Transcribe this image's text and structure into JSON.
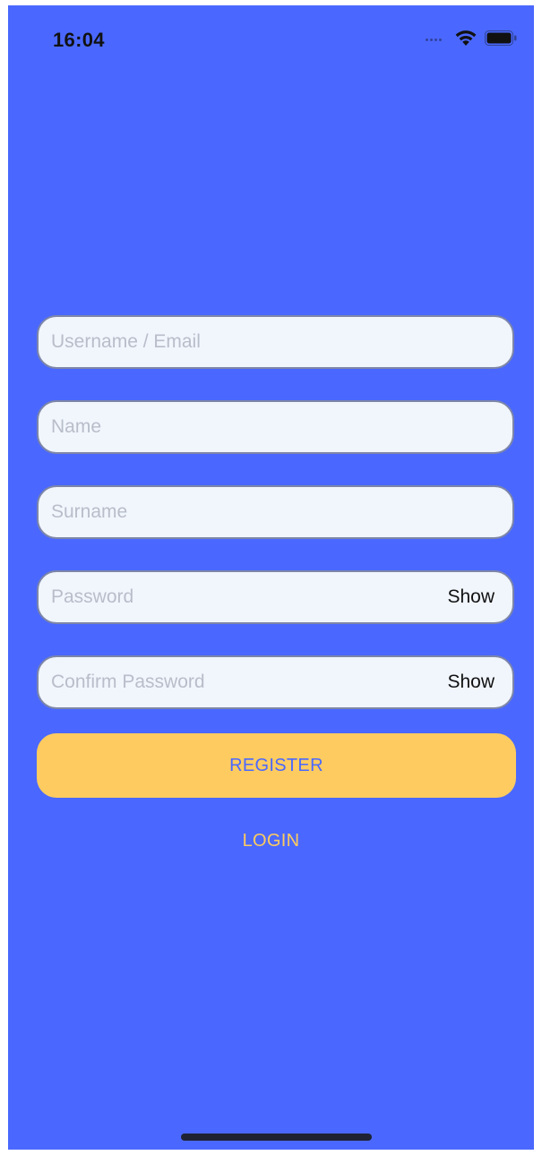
{
  "status_bar": {
    "time": "16:04",
    "signal_icon": "cellular-dots-icon",
    "wifi_icon": "wifi-icon",
    "battery_icon": "battery-icon"
  },
  "form": {
    "username": {
      "placeholder": "Username / Email",
      "value": ""
    },
    "name": {
      "placeholder": "Name",
      "value": ""
    },
    "surname": {
      "placeholder": "Surname",
      "value": ""
    },
    "password": {
      "placeholder": "Password",
      "value": "",
      "toggle_label": "Show"
    },
    "confirm_password": {
      "placeholder": "Confirm Password",
      "value": "",
      "toggle_label": "Show"
    }
  },
  "actions": {
    "register_label": "REGISTER",
    "login_label": "LOGIN"
  },
  "colors": {
    "background": "#4a68ff",
    "field_background": "#f1f6fd",
    "accent": "#fdcb5f"
  }
}
